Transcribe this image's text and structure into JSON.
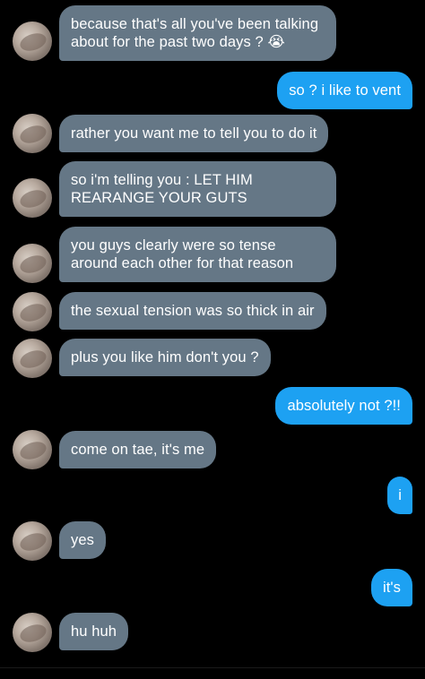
{
  "conversation": {
    "messages": [
      {
        "sender": "them",
        "text": "because that's all you've been talking about for the past two days ? 😭"
      },
      {
        "sender": "me",
        "text": "so ? i like to vent"
      },
      {
        "sender": "them",
        "text": "rather you want me to tell you to do it"
      },
      {
        "sender": "them",
        "text": "so i'm telling you : LET HIM REARANGE YOUR GUTS"
      },
      {
        "sender": "them",
        "text": "you guys clearly were so tense around each other for that reason"
      },
      {
        "sender": "them",
        "text": "the sexual tension was so thick in air"
      },
      {
        "sender": "them",
        "text": "plus you like him don't you ?"
      },
      {
        "sender": "me",
        "text": "absolutely not ?!!"
      },
      {
        "sender": "them",
        "text": "come on tae, it's me"
      },
      {
        "sender": "me",
        "text": "i"
      },
      {
        "sender": "them",
        "text": "yes"
      },
      {
        "sender": "me",
        "text": "it's"
      },
      {
        "sender": "them",
        "text": "hu huh"
      }
    ]
  },
  "colors": {
    "background": "#000000",
    "incoming_bubble": "#657786",
    "outgoing_bubble": "#1da1f2",
    "text": "#ffffff"
  }
}
